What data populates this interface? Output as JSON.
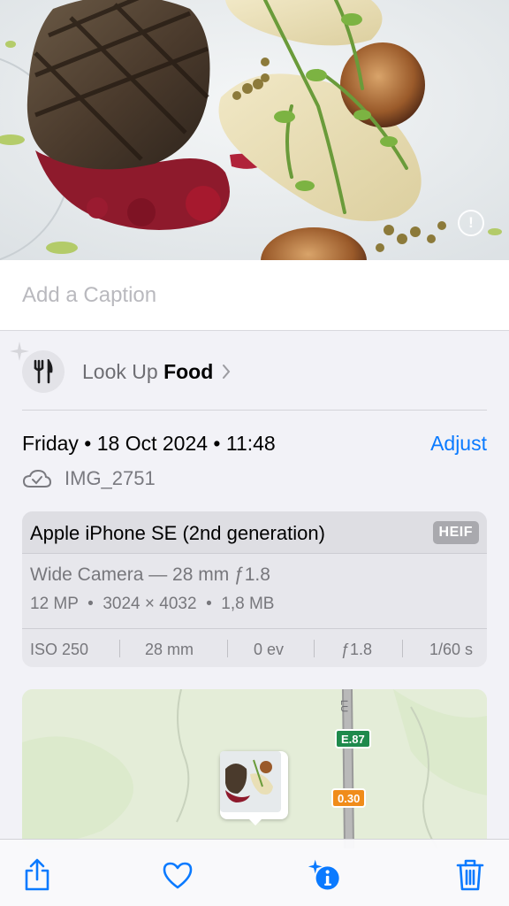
{
  "caption": {
    "placeholder": "Add a Caption"
  },
  "look_up": {
    "prefix": "Look Up",
    "subject": "Food",
    "icon": "fork-knife-icon"
  },
  "info": {
    "date_time": "Friday • 18 Oct 2024 • 11:48",
    "adjust_label": "Adjust",
    "file_name": "IMG_2751"
  },
  "camera": {
    "device": "Apple iPhone SE (2nd generation)",
    "format_badge": "HEIF",
    "lens": "Wide Camera — 28 mm ƒ1.8",
    "specs": "12 MP  •  3024 × 4032  •  1,8 MB",
    "exif": {
      "iso": "ISO 250",
      "focal": "28 mm",
      "ev": "0 ev",
      "aperture": "ƒ1.8",
      "shutter": "1/60 s"
    }
  },
  "map": {
    "road_label": "LU",
    "sign_green": "E.87",
    "sign_orange": "0.30",
    "colors": {
      "green": "#1e8a4c",
      "orange": "#f08c1a"
    }
  },
  "toolbar": {
    "share_icon": "share-icon",
    "favorite_icon": "heart-icon",
    "info_icon": "info-sparkle-icon",
    "delete_icon": "trash-icon",
    "accent": "#0a7aff"
  }
}
